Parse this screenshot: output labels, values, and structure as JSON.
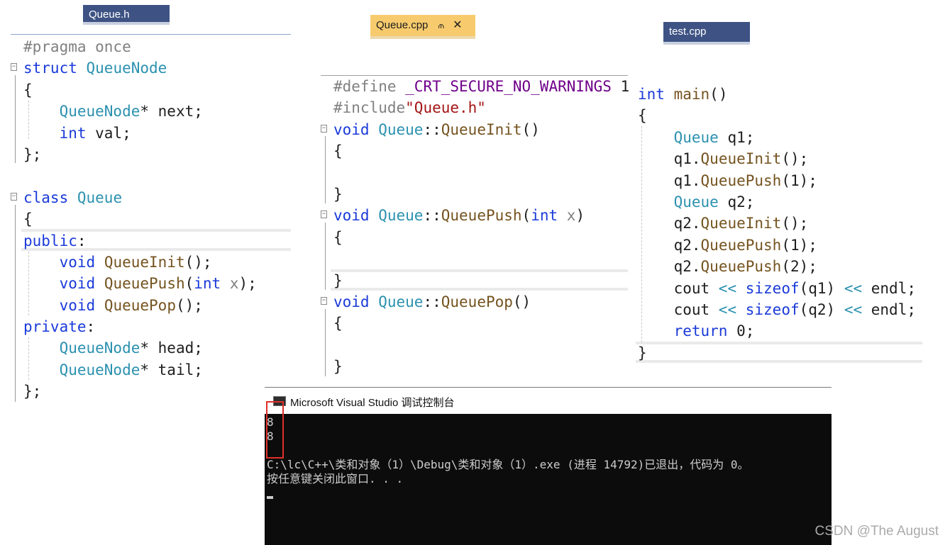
{
  "tabs": {
    "queue_h": "Queue.h",
    "queue_cpp": "Queue.cpp",
    "queue_cpp_pin": "⫙",
    "queue_cpp_close": "✕",
    "test_cpp": "test.cpp"
  },
  "queue_h": {
    "pragma": "#pragma once",
    "struct_kw": "struct",
    "struct_name": "QueueNode",
    "open_brace": "{",
    "next_type": "QueueNode",
    "next_rest": "* next;",
    "val_type": "int",
    "val_rest": " val;",
    "close_semi": "};",
    "class_kw": "class",
    "class_name": "Queue",
    "public_kw": "public",
    "colon": ":",
    "void": "void",
    "init_name": "QueueInit",
    "call_empty": "();",
    "push_name": "QueuePush",
    "paren_open": "(",
    "int": "int",
    "x": "x",
    "paren_close_semi": ");",
    "pop_name": "QueuePop",
    "private_kw": "private",
    "head_rest": "* head;",
    "tail_rest": "* tail;"
  },
  "queue_cpp": {
    "define": "#define ",
    "define_macro": "_CRT_SECURE_NO_WARNINGS",
    "define_value": " 1",
    "include": "#include",
    "include_file": "\"Queue.h\"",
    "void": "void",
    "class_name": "Queue",
    "scope": "::",
    "init_sig": "QueueInit",
    "push_sig": "QueuePush",
    "pop_sig": "QueuePop",
    "empty_parens": "()",
    "paren_open": "(",
    "int": "int",
    "x": "x",
    "paren_close": ")",
    "open_brace": "{",
    "close_brace": "}"
  },
  "test_cpp": {
    "int": "int",
    "main": "main",
    "parens": "()",
    "open_brace": "{",
    "type": "Queue",
    "q1_decl": " q1;",
    "q1": "q1",
    "q2": "q2",
    "q2_decl": " q2;",
    "dot": ".",
    "init": "QueueInit",
    "push": "QueuePush",
    "call_empty": "();",
    "arg1": "(1);",
    "arg2": "(2);",
    "cout": "cout ",
    "shift": "<<",
    "sizeof": "sizeof",
    "sizeof_q1": "(q1) ",
    "sizeof_q2": "(q2) ",
    "endl": " endl;",
    "return_kw": "return",
    "return_val": " 0;",
    "close_brace": "}"
  },
  "console": {
    "title": "Microsoft Visual Studio 调试控制台",
    "lines": [
      "8",
      "8",
      "",
      "C:\\lc\\C++\\类和对象（1）\\Debug\\类和对象（1）.exe (进程 14792)已退出，代码为 0。",
      "按任意键关闭此窗口. . ."
    ]
  },
  "watermark": "CSDN @The   August",
  "colors": {
    "keyword": "#1a3ad9",
    "type": "#2b91af",
    "function": "#74531f",
    "preprocessor": "#808080",
    "string": "#a31515",
    "macro": "#6f008a",
    "tab_inactive": "#3e5384",
    "tab_active": "#f7cb6d",
    "highlight_box": "#e0302a"
  }
}
